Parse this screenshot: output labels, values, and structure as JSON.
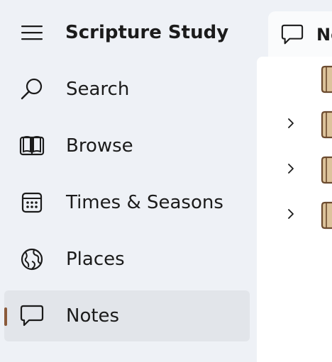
{
  "app": {
    "title": "Scripture Study"
  },
  "nav": {
    "menu_icon": "hamburger-menu-icon",
    "items": [
      {
        "id": "search",
        "label": "Search",
        "icon": "search-icon",
        "selected": false
      },
      {
        "id": "browse",
        "label": "Browse",
        "icon": "book-open-icon",
        "selected": false
      },
      {
        "id": "times-seasons",
        "label": "Times & Seasons",
        "icon": "calendar-icon",
        "selected": false
      },
      {
        "id": "places",
        "label": "Places",
        "icon": "globe-icon",
        "selected": false
      },
      {
        "id": "notes",
        "label": "Notes",
        "icon": "comment-icon",
        "selected": true
      }
    ]
  },
  "tab": {
    "label": "No",
    "icon": "comment-icon"
  },
  "tree": {
    "rows": [
      {
        "has_chevron": false,
        "icon": "folder-icon"
      },
      {
        "has_chevron": true,
        "icon": "folder-icon"
      },
      {
        "has_chevron": true,
        "icon": "folder-icon"
      },
      {
        "has_chevron": true,
        "icon": "folder-icon"
      }
    ]
  },
  "colors": {
    "accent": "#8a5a3b",
    "folder_fill": "#dcc39b",
    "folder_stroke": "#6b4a2e",
    "nav_background": "#eef1f6",
    "selected_background": "#e2e5ea",
    "content_background": "#ffffff"
  }
}
